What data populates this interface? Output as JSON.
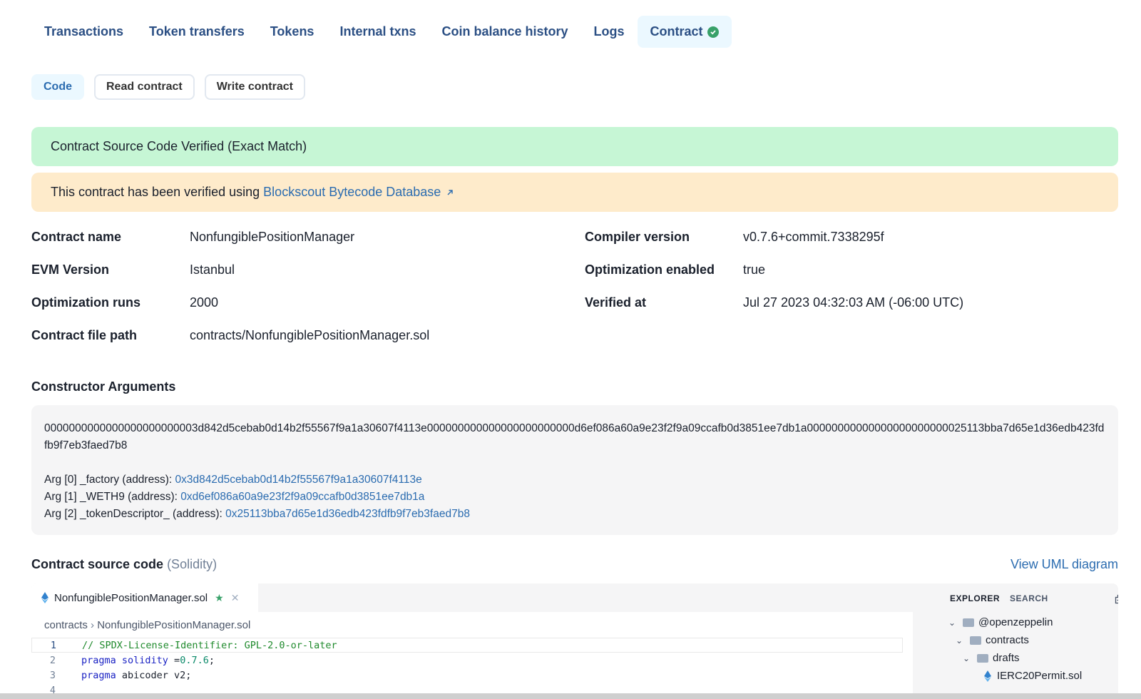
{
  "tabs": [
    {
      "label": "Transactions"
    },
    {
      "label": "Token transfers"
    },
    {
      "label": "Tokens"
    },
    {
      "label": "Internal txns"
    },
    {
      "label": "Coin balance history"
    },
    {
      "label": "Logs"
    },
    {
      "label": "Contract",
      "active": true
    }
  ],
  "subtabs": [
    {
      "label": "Code",
      "active": true
    },
    {
      "label": "Read contract"
    },
    {
      "label": "Write contract"
    }
  ],
  "alerts": {
    "verified": "Contract Source Code Verified (Exact Match)",
    "using_prefix": "This contract has been verified using",
    "using_link": "Blockscout Bytecode Database"
  },
  "details": {
    "contract_name": {
      "label": "Contract name",
      "value": "NonfungiblePositionManager"
    },
    "compiler_version": {
      "label": "Compiler version",
      "value": "v0.7.6+commit.7338295f"
    },
    "evm_version": {
      "label": "EVM Version",
      "value": "Istanbul"
    },
    "optimization_enabled": {
      "label": "Optimization enabled",
      "value": "true"
    },
    "optimization_runs": {
      "label": "Optimization runs",
      "value": "2000"
    },
    "verified_at": {
      "label": "Verified at",
      "value": "Jul 27 2023 04:32:03 AM (-06:00 UTC)"
    },
    "file_path": {
      "label": "Contract file path",
      "value": "contracts/NonfungiblePositionManager.sol"
    }
  },
  "constructor": {
    "title": "Constructor Arguments",
    "raw": "0000000000000000000000003d842d5cebab0d14b2f55567f9a1a30607f4113e000000000000000000000000d6ef086a60a9e23f2f9a09ccafb0d3851ee7db1a00000000000000000000000025113bba7d65e1d36edb423fdfb9f7eb3faed7b8",
    "args": [
      {
        "label": "Arg [0] _factory (address):",
        "value": "0x3d842d5cebab0d14b2f55567f9a1a30607f4113e"
      },
      {
        "label": "Arg [1] _WETH9 (address):",
        "value": "0xd6ef086a60a9e23f2f9a09ccafb0d3851ee7db1a"
      },
      {
        "label": "Arg [2] _tokenDescriptor_ (address):",
        "value": "0x25113bba7d65e1d36edb423fdfb9f7eb3faed7b8"
      }
    ]
  },
  "source": {
    "title": "Contract source code",
    "language": "(Solidity)",
    "uml_link": "View UML diagram",
    "file_tab": "NonfungiblePositionManager.sol",
    "breadcrumb_folder": "contracts",
    "breadcrumb_file": "NonfungiblePositionManager.sol",
    "lines": [
      {
        "n": "1",
        "parts": [
          {
            "t": "// SPDX-License-Identifier: GPL-2.0-or-later",
            "c": "cm"
          }
        ]
      },
      {
        "n": "2",
        "parts": [
          {
            "t": "pragma solidity ",
            "c": "kw"
          },
          {
            "t": "=",
            "c": ""
          },
          {
            "t": "0.7.6",
            "c": "num"
          },
          {
            "t": ";",
            "c": ""
          }
        ]
      },
      {
        "n": "3",
        "parts": [
          {
            "t": "pragma ",
            "c": "kw"
          },
          {
            "t": "abicoder v2;",
            "c": ""
          }
        ]
      },
      {
        "n": "4",
        "parts": []
      }
    ]
  },
  "explorer": {
    "tab_explorer": "EXPLORER",
    "tab_search": "SEARCH",
    "tree": [
      {
        "label": "@openzeppelin",
        "type": "folder",
        "depth": 0
      },
      {
        "label": "contracts",
        "type": "folder",
        "depth": 1
      },
      {
        "label": "drafts",
        "type": "folder",
        "depth": 2
      },
      {
        "label": "IERC20Permit.sol",
        "type": "file",
        "depth": 3
      }
    ]
  },
  "colors": {
    "accent": "#2b6cb0",
    "verified_bg": "#c6f6d5",
    "notice_bg": "#feebcb",
    "success": "#38a169"
  }
}
